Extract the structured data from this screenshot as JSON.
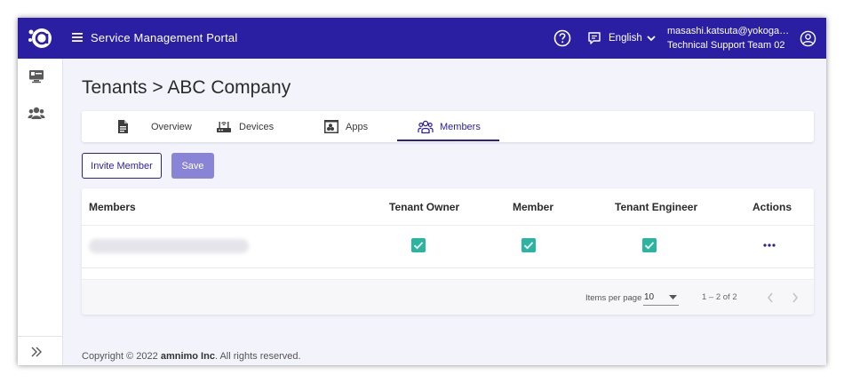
{
  "header": {
    "app_title": "Service Management Portal",
    "language": "English",
    "user_email": "masashi.katsuta@yokogawa.com",
    "user_team": "Technical Support Team 02"
  },
  "breadcrumb": {
    "text": "Tenants > ABC Company"
  },
  "tabs": [
    {
      "label": "Overview",
      "icon": "document-icon",
      "active": false
    },
    {
      "label": "Devices",
      "icon": "router-icon",
      "active": false
    },
    {
      "label": "Apps",
      "icon": "apps-icon",
      "active": false
    },
    {
      "label": "Members",
      "icon": "members-icon",
      "active": true
    }
  ],
  "actions": {
    "invite_label": "Invite Member",
    "save_label": "Save"
  },
  "table": {
    "columns": [
      "Members",
      "Tenant Owner",
      "Member",
      "Tenant Engineer",
      "Actions"
    ],
    "rows": [
      {
        "member": "",
        "tenant_owner": true,
        "member_role": true,
        "tenant_engineer": true
      }
    ]
  },
  "pagination": {
    "items_per_page_label": "Items per page",
    "items_per_page": "10",
    "range": "1 – 2 of 2"
  },
  "footer": {
    "prefix": "Copyright © 2022 ",
    "company": "amnimo Inc",
    "suffix": ". All rights reserved."
  },
  "colors": {
    "brand": "#2a1fa3",
    "check": "#2ab5a0",
    "save_disabled": "#8a84d6"
  }
}
